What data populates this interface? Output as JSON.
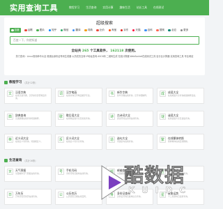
{
  "header": {
    "logo": "实用查询工具",
    "nav": [
      "教程学习",
      "生活查询",
      "实用计算",
      "趣味生活",
      "站长工具",
      "在线测试"
    ]
  },
  "search": {
    "title": "超级搜索",
    "engines": [
      {
        "label": "百度",
        "color": "#2b5bdc",
        "active": true
      },
      {
        "label": "谷歌",
        "color": "#ea4335"
      },
      {
        "label": "图片",
        "color": "#4caf50"
      },
      {
        "label": "知乎",
        "color": "#0084ff"
      },
      {
        "label": "微信",
        "color": "#2aae67"
      },
      {
        "label": "翻译",
        "color": "#3b8ff7"
      },
      {
        "label": "词典",
        "color": "#f39c12"
      },
      {
        "label": "比价",
        "color": "#e74c3c"
      },
      {
        "label": "淘宝",
        "color": "#ff5000"
      },
      {
        "label": "京东",
        "color": "#e1251b"
      },
      {
        "label": "天猫",
        "color": "#ff0036"
      },
      {
        "label": "百科",
        "color": "#3b8ff7"
      },
      {
        "label": "搜狗",
        "color": "#fd6853"
      },
      {
        "label": "必应",
        "color": "#008373"
      },
      {
        "label": "更多",
        "color": "#888888"
      }
    ],
    "placeholder": "百度一下，你就知道",
    "stats_prefix": "全站共",
    "stats_tools": "265",
    "stats_middle": "个工具软件，",
    "stats_queries": "162118",
    "stats_suffix": "次使用。",
    "hot_links": "热门查询：Linux常用命令大全 港澳台身份证号码生成器 公历农历互转 IP地址查询 ASCII码 二维码生成 在线计算器 WebSocket在线测试工具 百分比计算器 实用查询工具 专业网站"
  },
  "sections": [
    {
      "title": "教程学习",
      "count": "（共计12条）",
      "tools": [
        {
          "icon": "文",
          "name": "汉语字典",
          "desc": "在线汉语字典，汉字拼音部首笔画查询。"
        },
        {
          "icon": "词",
          "name": "汉字笔画",
          "desc": "在线查询汉字笔画顺序写法。"
        },
        {
          "icon": "书",
          "name": "新华字典",
          "desc": "新华字典在线查询，汉字详细解释。"
        },
        {
          "icon": "成",
          "name": "成语大全",
          "desc": "在线成语大全查询成语解释出处。"
        },
        {
          "icon": "典",
          "name": "辞典查询",
          "desc": "汉语辞典在线查询词语解释。"
        },
        {
          "icon": "歇",
          "name": "歇后语大全",
          "desc": "在线歇后语大全及答案查询。"
        },
        {
          "icon": "诗",
          "name": "古诗词大全",
          "desc": "唐诗宋词古诗词在线查询。"
        },
        {
          "icon": "谜",
          "name": "谜语大全",
          "desc": "在线谜语大全及谜底查询。"
        },
        {
          "icon": "英",
          "name": "近义词大全",
          "desc": "在线近义词查询，词语相近义。"
        },
        {
          "icon": "反",
          "name": "反义词大全",
          "desc": "在线反义词大全查询。"
        },
        {
          "icon": "造",
          "name": "造句大全",
          "desc": "词语造句在线查询。"
        },
        {
          "icon": "繁",
          "name": "在线繁体转换",
          "desc": "简体繁体在线互相转换。"
        }
      ]
    },
    {
      "title": "生活查询",
      "count": "（共计16条）",
      "tools": [
        {
          "icon": "天",
          "name": "天气预报",
          "desc": "全国城市天气预报在线查询。"
        },
        {
          "icon": "号",
          "name": "手机号码",
          "desc": "手机号码归属地在线查询。"
        },
        {
          "icon": "邮",
          "name": "邮编查询",
          "desc": "全国邮政编码在线查询。"
        },
        {
          "icon": "区",
          "name": "区号查询",
          "desc": "全国电话区号在线查询。"
        },
        {
          "icon": "日",
          "name": "万年历",
          "desc": "万年历农历黄历在线查询。"
        },
        {
          "icon": "公",
          "name": "公历农历",
          "desc": "公历农历日期在线互转。"
        },
        {
          "icon": "身",
          "name": "身份证查询",
          "desc": "身份证号码归属地信息查询。"
        },
        {
          "icon": "星",
          "name": "星座运势",
          "desc": "十二星座每日运势查询。"
        }
      ]
    }
  ],
  "watermark": {
    "title": "酷数据",
    "subtitle": "KUIDC"
  }
}
